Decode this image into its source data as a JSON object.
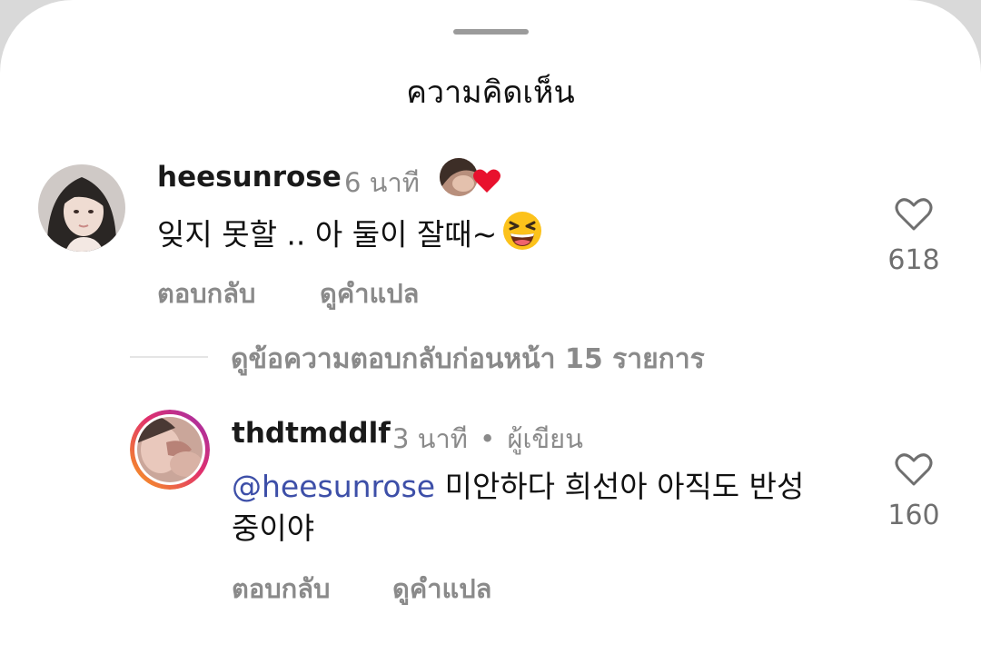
{
  "sheet": {
    "title": "ความคิดเห็น"
  },
  "comments": [
    {
      "username": "heesunrose",
      "time": "6 นาที",
      "text": "잊지 못할 .. 아 둘이 잘때~",
      "emoji": "laughing-squinting-face",
      "creator_liked": true,
      "like_count": "618",
      "reply_label": "ตอบกลับ",
      "translate_label": "ดูคำแปล"
    }
  ],
  "view_replies": {
    "label": "ดูข้อความตอบกลับก่อนหน้า 15 รายการ"
  },
  "replies": [
    {
      "username": "thdtmddlf",
      "time": "3 นาที",
      "separator": "•",
      "author_badge": "ผู้เขียน",
      "mention": "@heesunrose",
      "text": "미안하다 희선아 아직도 반성 중이야",
      "like_count": "160",
      "reply_label": "ตอบกลับ",
      "translate_label": "ดูคำแปล"
    }
  ],
  "colors": {
    "mention": "#3d4fa8",
    "heart_red": "#e8112d",
    "muted": "#8a8a8a",
    "story_ring": [
      "#f9a21b",
      "#e1306c",
      "#9b2fae"
    ]
  }
}
